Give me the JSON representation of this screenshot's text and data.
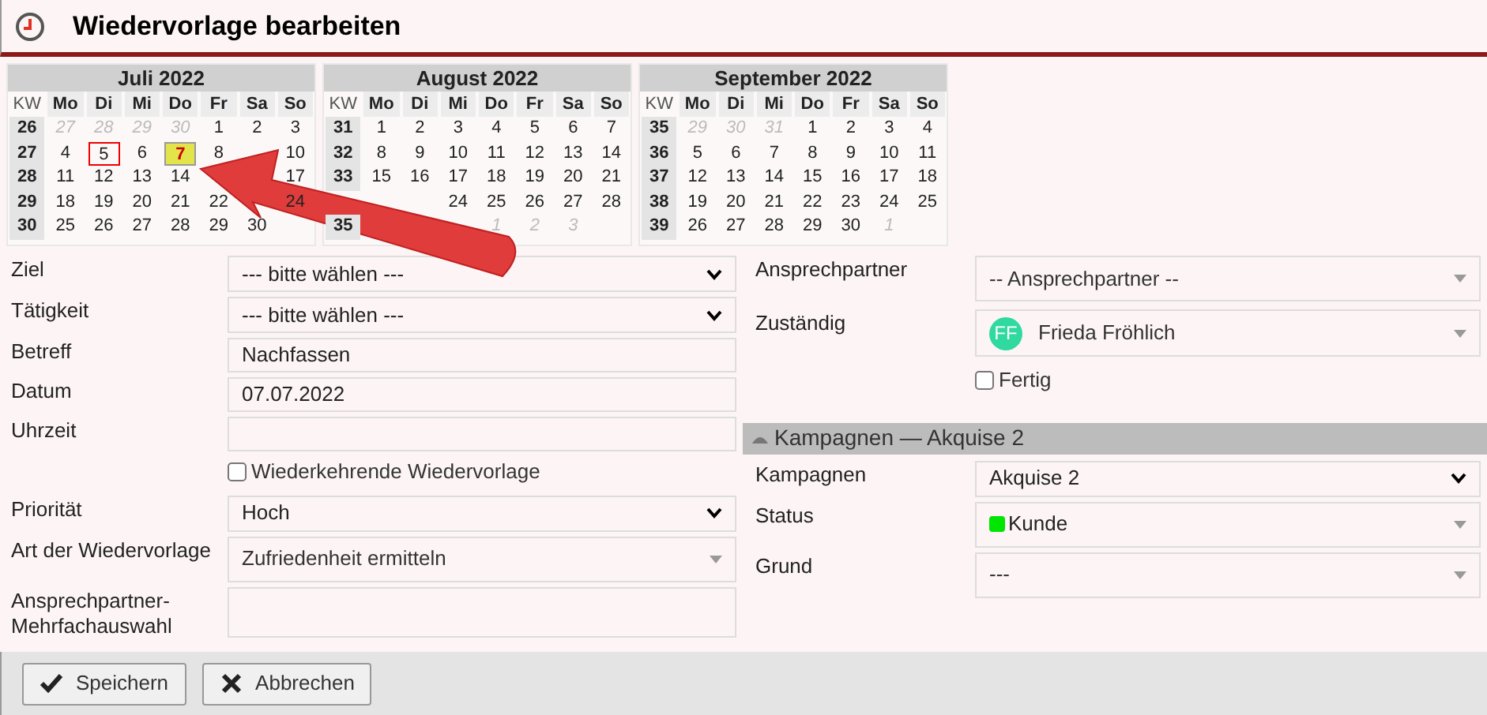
{
  "title": "Wiedervorlage bearbeiten",
  "months": [
    {
      "title": "Juli 2022",
      "kw_header": "KW",
      "weekdays": [
        "Mo",
        "Di",
        "Mi",
        "Do",
        "Fr",
        "Sa",
        "So"
      ],
      "weeks": [
        {
          "kw": "26",
          "days": [
            {
              "d": "27",
              "kind": "outside"
            },
            {
              "d": "28",
              "kind": "outside"
            },
            {
              "d": "29",
              "kind": "outside"
            },
            {
              "d": "30",
              "kind": "outside"
            },
            {
              "d": "1",
              "kind": "day"
            },
            {
              "d": "2",
              "kind": "day"
            },
            {
              "d": "3",
              "kind": "day"
            }
          ]
        },
        {
          "kw": "27",
          "days": [
            {
              "d": "4",
              "kind": "day"
            },
            {
              "d": "5",
              "kind": "today"
            },
            {
              "d": "6",
              "kind": "day"
            },
            {
              "d": "7",
              "kind": "selected"
            },
            {
              "d": "8",
              "kind": "day"
            },
            {
              "kind": "covered"
            },
            {
              "d": "10",
              "kind": "day"
            }
          ]
        },
        {
          "kw": "28",
          "days": [
            {
              "d": "11",
              "kind": "day"
            },
            {
              "d": "12",
              "kind": "day"
            },
            {
              "d": "13",
              "kind": "day"
            },
            {
              "d": "14",
              "kind": "day"
            },
            {
              "kind": "covered"
            },
            {
              "kind": "covered"
            },
            {
              "d": "17",
              "kind": "day"
            }
          ]
        },
        {
          "kw": "29",
          "days": [
            {
              "d": "18",
              "kind": "day"
            },
            {
              "d": "19",
              "kind": "day"
            },
            {
              "d": "20",
              "kind": "day"
            },
            {
              "d": "21",
              "kind": "day"
            },
            {
              "d": "22",
              "kind": "day"
            },
            {
              "kind": "covered"
            },
            {
              "d": "24",
              "kind": "day"
            }
          ]
        },
        {
          "kw": "30",
          "days": [
            {
              "d": "25",
              "kind": "day"
            },
            {
              "d": "26",
              "kind": "day"
            },
            {
              "d": "27",
              "kind": "day"
            },
            {
              "d": "28",
              "kind": "day"
            },
            {
              "d": "29",
              "kind": "day"
            },
            {
              "d": "30",
              "kind": "day"
            }
          ]
        }
      ]
    },
    {
      "title": "August 2022",
      "kw_header": "KW",
      "weekdays": [
        "Mo",
        "Di",
        "Mi",
        "Do",
        "Fr",
        "Sa",
        "So"
      ],
      "weeks": [
        {
          "kw": "31",
          "days": [
            {
              "d": "1",
              "kind": "day"
            },
            {
              "d": "2",
              "kind": "day"
            },
            {
              "d": "3",
              "kind": "day"
            },
            {
              "d": "4",
              "kind": "day"
            },
            {
              "d": "5",
              "kind": "day"
            },
            {
              "d": "6",
              "kind": "day"
            },
            {
              "d": "7",
              "kind": "day"
            }
          ]
        },
        {
          "kw": "32",
          "days": [
            {
              "d": "8",
              "kind": "day"
            },
            {
              "d": "9",
              "kind": "day"
            },
            {
              "d": "10",
              "kind": "day"
            },
            {
              "d": "11",
              "kind": "day"
            },
            {
              "d": "12",
              "kind": "day"
            },
            {
              "d": "13",
              "kind": "day"
            },
            {
              "d": "14",
              "kind": "day"
            }
          ]
        },
        {
          "kw": "33",
          "days": [
            {
              "d": "15",
              "kind": "day"
            },
            {
              "d": "16",
              "kind": "day"
            },
            {
              "d": "17",
              "kind": "day"
            },
            {
              "d": "18",
              "kind": "day"
            },
            {
              "d": "19",
              "kind": "day"
            },
            {
              "d": "20",
              "kind": "day"
            },
            {
              "d": "21",
              "kind": "day"
            }
          ]
        },
        {
          "days": [
            {
              "kind": "covered"
            },
            {
              "kind": "covered"
            },
            {
              "d": "24",
              "kind": "day"
            },
            {
              "d": "25",
              "kind": "day"
            },
            {
              "d": "26",
              "kind": "day"
            },
            {
              "d": "27",
              "kind": "day"
            },
            {
              "d": "28",
              "kind": "day"
            }
          ]
        },
        {
          "kw": "35",
          "days": [
            {
              "kind": "covered"
            },
            {
              "kind": "covered"
            },
            {
              "kind": "covered"
            },
            {
              "d": "1",
              "kind": "outside"
            },
            {
              "d": "2",
              "kind": "outside"
            },
            {
              "d": "3",
              "kind": "outside"
            }
          ]
        }
      ]
    },
    {
      "title": "September 2022",
      "kw_header": "KW",
      "weekdays": [
        "Mo",
        "Di",
        "Mi",
        "Do",
        "Fr",
        "Sa",
        "So"
      ],
      "weeks": [
        {
          "kw": "35",
          "days": [
            {
              "d": "29",
              "kind": "outside"
            },
            {
              "d": "30",
              "kind": "outside"
            },
            {
              "d": "31",
              "kind": "outside"
            },
            {
              "d": "1",
              "kind": "day"
            },
            {
              "d": "2",
              "kind": "day"
            },
            {
              "d": "3",
              "kind": "day"
            },
            {
              "d": "4",
              "kind": "day"
            }
          ]
        },
        {
          "kw": "36",
          "days": [
            {
              "d": "5",
              "kind": "day"
            },
            {
              "d": "6",
              "kind": "day"
            },
            {
              "d": "7",
              "kind": "day"
            },
            {
              "d": "8",
              "kind": "day"
            },
            {
              "d": "9",
              "kind": "day"
            },
            {
              "d": "10",
              "kind": "day"
            },
            {
              "d": "11",
              "kind": "day"
            }
          ]
        },
        {
          "kw": "37",
          "days": [
            {
              "d": "12",
              "kind": "day"
            },
            {
              "d": "13",
              "kind": "day"
            },
            {
              "d": "14",
              "kind": "day"
            },
            {
              "d": "15",
              "kind": "day"
            },
            {
              "d": "16",
              "kind": "day"
            },
            {
              "d": "17",
              "kind": "day"
            },
            {
              "d": "18",
              "kind": "day"
            }
          ]
        },
        {
          "kw": "38",
          "days": [
            {
              "d": "19",
              "kind": "day"
            },
            {
              "d": "20",
              "kind": "day"
            },
            {
              "d": "21",
              "kind": "day"
            },
            {
              "d": "22",
              "kind": "day"
            },
            {
              "d": "23",
              "kind": "day"
            },
            {
              "d": "24",
              "kind": "day"
            },
            {
              "d": "25",
              "kind": "day"
            }
          ]
        },
        {
          "kw": "39",
          "days": [
            {
              "d": "26",
              "kind": "day"
            },
            {
              "d": "27",
              "kind": "day"
            },
            {
              "d": "28",
              "kind": "day"
            },
            {
              "d": "29",
              "kind": "day"
            },
            {
              "d": "30",
              "kind": "day"
            },
            {
              "d": "1",
              "kind": "outside"
            }
          ]
        }
      ]
    }
  ],
  "left_fields": [
    {
      "kind": "select",
      "label": "Ziel",
      "value": "--- bitte wählen ---"
    },
    {
      "kind": "select",
      "label": "Tätigkeit",
      "value": "--- bitte wählen ---"
    },
    {
      "kind": "input",
      "label": "Betreff",
      "value": "Nachfassen"
    },
    {
      "kind": "input",
      "label": "Datum",
      "value": "07.07.2022"
    },
    {
      "kind": "input",
      "label": "Uhrzeit"
    },
    {
      "kind": "checkbox",
      "label": "Wiederkehrende Wiedervorlage",
      "checked": false
    },
    {
      "kind": "select",
      "label": "Priorität",
      "value": "Hoch"
    },
    {
      "kind": "combo",
      "label": "Art der Wiedervorlage",
      "value": "Zufriedenheit ermitteln"
    },
    {
      "kind": "textarea",
      "label": "Ansprechpartner-Mehrfachauswahl"
    }
  ],
  "right_fields": [
    {
      "kind": "combo",
      "label": "Ansprechpartner",
      "value": "-- Ansprechpartner --"
    },
    {
      "kind": "person",
      "label": "Zuständig",
      "value": "Frieda Fröhlich",
      "initials": "FF"
    },
    {
      "kind": "checkbox",
      "label": "Fertig",
      "checked": false
    },
    {
      "kind": "section",
      "label": "Kampagnen — Akquise 2"
    },
    {
      "kind": "select",
      "label": "Kampagnen",
      "value": "Akquise 2"
    },
    {
      "kind": "status",
      "label": "Status",
      "value": "Kunde",
      "color": "#00e600"
    },
    {
      "kind": "combo",
      "label": "Grund",
      "value": "---"
    }
  ],
  "buttons": [
    {
      "kind": "save",
      "label": "Speichern"
    },
    {
      "kind": "cancel",
      "label": "Abbrechen"
    }
  ]
}
